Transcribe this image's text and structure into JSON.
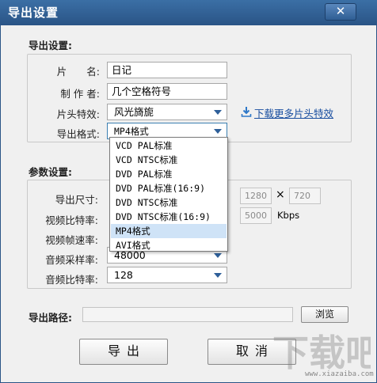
{
  "window": {
    "title": "导出设置",
    "close_symbol": "✕"
  },
  "export_settings": {
    "section_label": "导出设置:",
    "name_label": "片　　名:",
    "name_value": "日记",
    "author_label": "制 作 者:",
    "author_value": "几个空格符号",
    "intro_effect_label": "片头特效:",
    "intro_effect_value": "风光旖旎",
    "download_link": "下载更多片头特效",
    "format_label": "导出格式:",
    "format_value": "MP4格式"
  },
  "format_dropdown": {
    "options": [
      "VCD PAL标准",
      "VCD NTSC标准",
      "DVD PAL标准",
      "DVD PAL标准(16:9)",
      "DVD NTSC标准",
      "DVD NTSC标准(16:9)",
      "MP4格式",
      "AVI格式"
    ],
    "selected_index": 6
  },
  "parameters": {
    "section_label": "参数设置:",
    "size_label": "导出尺寸:",
    "width_value": "1280",
    "times_symbol": "×",
    "height_value": "720",
    "video_bitrate_label": "视频比特率:",
    "video_bitrate_value": "5000",
    "video_bitrate_unit": "Kbps",
    "frame_rate_label": "视频帧速率:",
    "audio_sample_label": "音频采样率:",
    "audio_sample_value": "48000",
    "audio_bitrate_label": "音频比特率:",
    "audio_bitrate_value": "128"
  },
  "export_path": {
    "label": "导出路径:",
    "value": "",
    "browse_label": "浏览"
  },
  "actions": {
    "export_label": "导出",
    "cancel_label": "取消"
  },
  "watermark": {
    "text": "下载吧",
    "url": "www.xiazaiba.com"
  },
  "colors": {
    "titlebar": "#2f5e94",
    "selection": "#cfe3f7",
    "link": "#1a4fa0",
    "arrow": "#2e5f99"
  }
}
